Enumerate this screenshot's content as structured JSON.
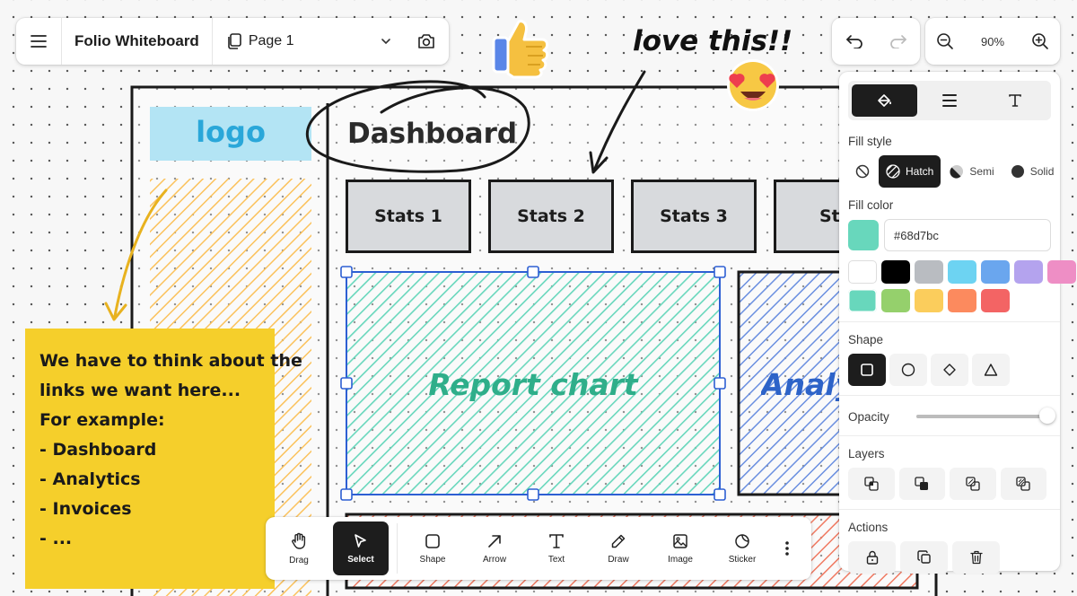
{
  "app": {
    "title": "Folio Whiteboard"
  },
  "page_selector": {
    "label": "Page 1"
  },
  "zoom": {
    "level": "90%"
  },
  "canvas": {
    "logo_text": "logo",
    "dashboard_text": "Dashboard",
    "annotation": "love this!!",
    "stats": [
      "Stats 1",
      "Stats 2",
      "Stats 3",
      "Sta"
    ],
    "report_chart": "Report chart",
    "analytics_fragment": "Analyt",
    "sticky_note": [
      "We have to think about the",
      "links we want here...",
      "For example:",
      "- Dashboard",
      "- Analytics",
      "- Invoices",
      "- ..."
    ]
  },
  "style_panel": {
    "fill_style_label": "Fill style",
    "fill_options": [
      {
        "label": "",
        "icon": "no-fill-icon",
        "active": false
      },
      {
        "label": "Hatch",
        "icon": "hatch-icon",
        "active": true
      },
      {
        "label": "Semi",
        "icon": "semi-fill-icon",
        "active": false
      },
      {
        "label": "Solid",
        "icon": "solid-fill-icon",
        "active": false
      }
    ],
    "fill_color_label": "Fill color",
    "fill_color_value": "#68d7bc",
    "swatches": [
      "#ffffff",
      "#000000",
      "#b9bcc1",
      "#6dd3f2",
      "#6aa6ee",
      "#b4a3ee",
      "#ee8ec5",
      "#68d7bc",
      "#95d06c",
      "#fbcd5c",
      "#fc8a5e",
      "#f36464"
    ],
    "shape_label": "Shape",
    "opacity_label": "Opacity",
    "opacity_value": 1.0,
    "layers_label": "Layers",
    "actions_label": "Actions"
  },
  "tools": [
    {
      "label": "Drag",
      "icon": "hand-icon",
      "active": false
    },
    {
      "label": "Select",
      "icon": "cursor-icon",
      "active": true
    },
    {
      "label": "Shape",
      "icon": "square-icon",
      "active": false
    },
    {
      "label": "Arrow",
      "icon": "arrow-icon",
      "active": false
    },
    {
      "label": "Text",
      "icon": "text-icon",
      "active": false
    },
    {
      "label": "Draw",
      "icon": "pencil-icon",
      "active": false
    },
    {
      "label": "Image",
      "icon": "image-icon",
      "active": false
    },
    {
      "label": "Sticker",
      "icon": "sticker-icon",
      "active": false
    }
  ],
  "colors": {
    "selection": "#2d5fd3",
    "hatch_teal": "#68d7bc",
    "hatch_blue": "#6a8fe0",
    "hatch_orange": "#fbc25c",
    "hatch_red": "#f07a62",
    "logo_bg": "#b3e4f4",
    "sticky": "#f5cf2b"
  }
}
